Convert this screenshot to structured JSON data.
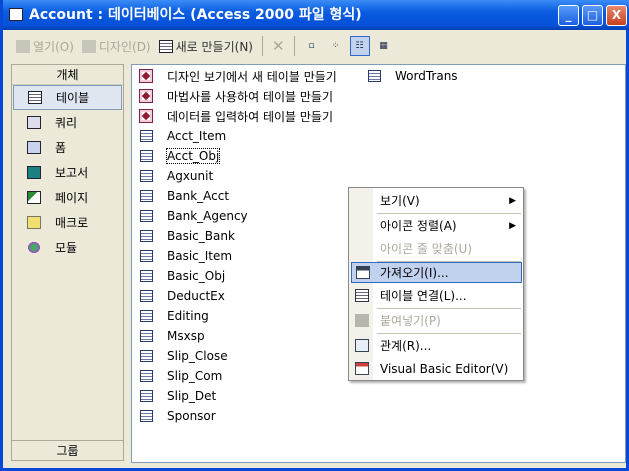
{
  "window": {
    "title": "Account : 데이터베이스 (Access 2000 파일 형식)",
    "minimize": "_",
    "maximize": "□",
    "close": "X"
  },
  "toolbar": {
    "open": "열기(O)",
    "design": "디자인(D)",
    "new": "새로 만들기(N)",
    "delete": "✕",
    "view_large": "▫",
    "view_small": "⁘",
    "view_list": "☷",
    "view_details": "▦"
  },
  "objects": {
    "header": "개체",
    "items": [
      {
        "label": "테이블"
      },
      {
        "label": "쿼리"
      },
      {
        "label": "폼"
      },
      {
        "label": "보고서"
      },
      {
        "label": "페이지"
      },
      {
        "label": "매크로"
      },
      {
        "label": "모듈"
      }
    ],
    "groups": "그룹"
  },
  "list": {
    "shortcuts": [
      "디자인 보기에서 새 테이블 만들기",
      "마법사를 사용하여 테이블 만들기",
      "데이터를 입력하여 테이블 만들기"
    ],
    "tables": [
      "Acct_Item",
      "Acct_Obj",
      "Agxunit",
      "Bank_Acct",
      "Bank_Agency",
      "Basic_Bank",
      "Basic_Item",
      "Basic_Obj",
      "DeductEx",
      "Editing",
      "Msxsp",
      "Slip_Close",
      "Slip_Com",
      "Slip_Det",
      "Sponsor",
      "WordTrans"
    ]
  },
  "menu": {
    "items": [
      {
        "label": "보기(V)"
      },
      {
        "label": "아이콘 정렬(A)"
      },
      {
        "label": "아이콘 줄 맞춤(U)"
      },
      {
        "label": "가져오기(I)..."
      },
      {
        "label": "테이블 연결(L)..."
      },
      {
        "label": "붙여넣기(P)"
      },
      {
        "label": "관계(R)..."
      },
      {
        "label": "Visual Basic Editor(V)"
      }
    ],
    "submenu_arrow": "▶"
  }
}
